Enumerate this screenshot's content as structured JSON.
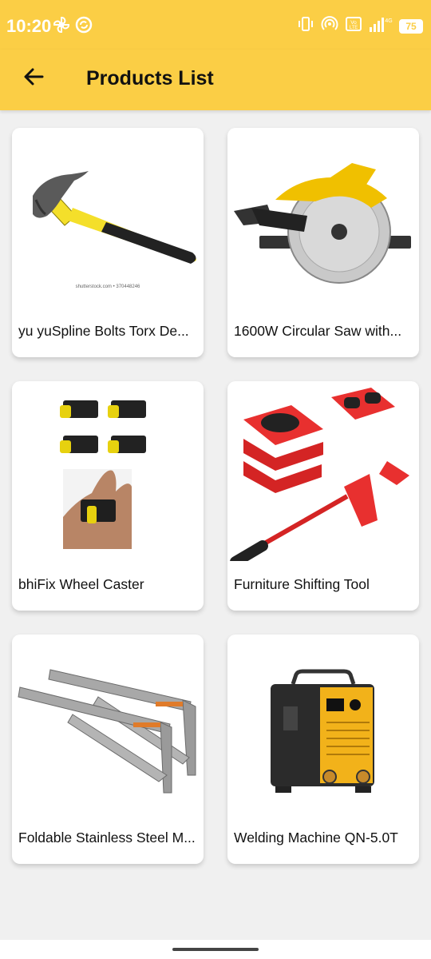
{
  "status_bar": {
    "time": "10:20",
    "battery": "75",
    "left_icons": [
      "fan-icon",
      "sync-icon"
    ],
    "right_icons": [
      "vibrate-icon",
      "hotspot-icon",
      "volte-icon",
      "signal-icon",
      "battery-icon"
    ]
  },
  "app_bar": {
    "title": "Products List",
    "back_icon": "arrow-left-icon",
    "background": "#fbce45"
  },
  "products": [
    {
      "title": "yu yuSpline Bolts Torx  De...",
      "image": "hammer-image",
      "image_caption": "shutterstock.com • 370448246"
    },
    {
      "title": "1600W Circular Saw with...",
      "image": "circular-saw-image"
    },
    {
      "title": "bhiFix Wheel  Caster",
      "image": "wheel-caster-image"
    },
    {
      "title": "Furniture Shifting Tool",
      "image": "furniture-lifter-image"
    },
    {
      "title": "Foldable Stainless Steel M...",
      "image": "steel-bracket-image"
    },
    {
      "title": "Welding Machine QN-5.0T",
      "image": "welding-machine-image"
    }
  ]
}
